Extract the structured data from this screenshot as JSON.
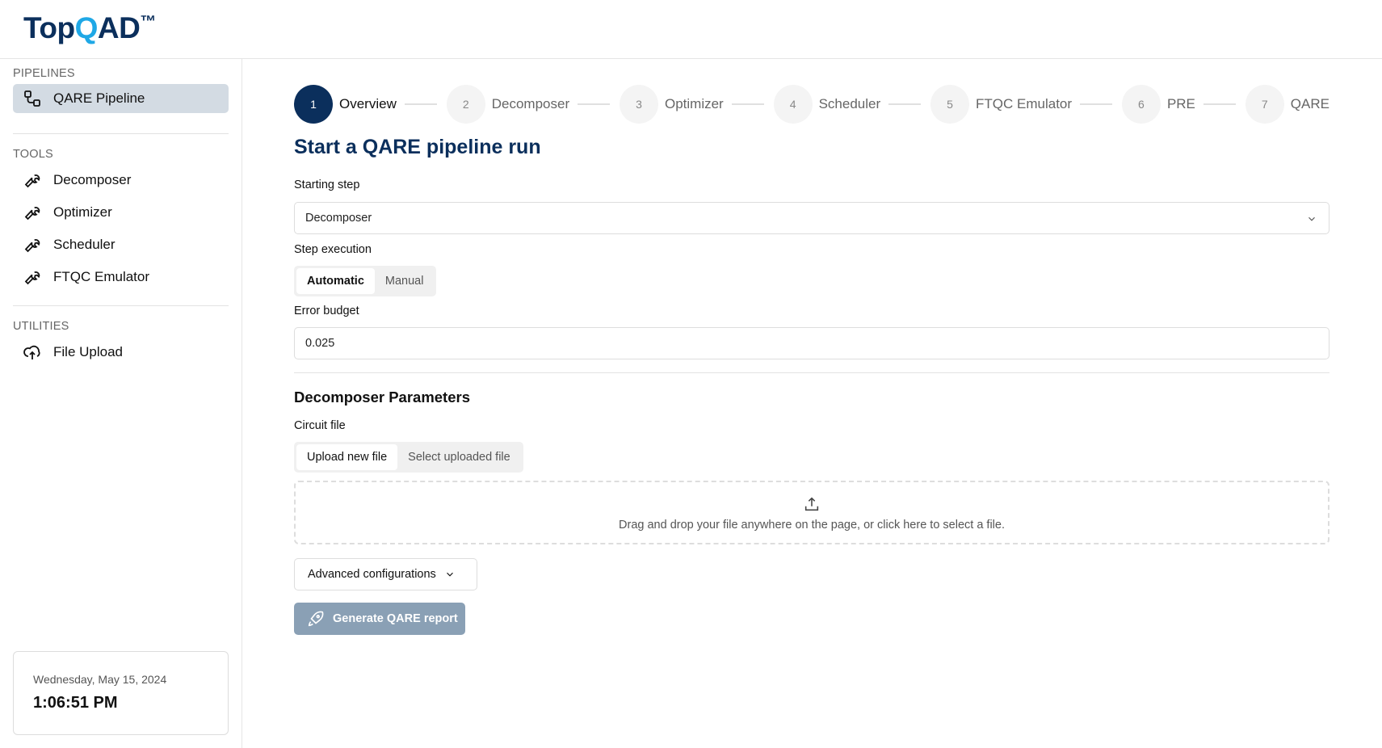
{
  "header": {
    "logo": "TopQAD™"
  },
  "sidebar": {
    "sections": [
      {
        "title": "PIPELINES",
        "items": [
          {
            "label": "QARE Pipeline",
            "icon": "workflow-icon",
            "active": true
          }
        ]
      },
      {
        "title": "TOOLS",
        "items": [
          {
            "label": "Decomposer",
            "icon": "wrench-icon"
          },
          {
            "label": "Optimizer",
            "icon": "wrench-icon"
          },
          {
            "label": "Scheduler",
            "icon": "wrench-icon"
          },
          {
            "label": "FTQC Emulator",
            "icon": "wrench-icon"
          }
        ]
      },
      {
        "title": "UTILITIES",
        "items": [
          {
            "label": "File Upload",
            "icon": "cloud-upload-icon"
          }
        ]
      }
    ],
    "clock": {
      "date": "Wednesday, May 15, 2024",
      "time": "1:06:51 PM"
    }
  },
  "stepper": [
    {
      "num": "1",
      "label": "Overview",
      "active": true
    },
    {
      "num": "2",
      "label": "Decomposer"
    },
    {
      "num": "3",
      "label": "Optimizer"
    },
    {
      "num": "4",
      "label": "Scheduler"
    },
    {
      "num": "5",
      "label": "FTQC Emulator"
    },
    {
      "num": "6",
      "label": "PRE"
    },
    {
      "num": "7",
      "label": "QARE"
    }
  ],
  "form": {
    "title": "Start a QARE pipeline run",
    "starting_step_label": "Starting step",
    "starting_step_value": "Decomposer",
    "step_execution_label": "Step execution",
    "step_execution_options": [
      "Automatic",
      "Manual"
    ],
    "error_budget_label": "Error budget",
    "error_budget_value": "0.025",
    "params_title": "Decomposer Parameters",
    "circuit_file_label": "Circuit file",
    "circuit_file_options": [
      "Upload new file",
      "Select uploaded file"
    ],
    "dropzone_text": "Drag and drop your file anywhere on the page, or click here to select a file.",
    "advanced_label": "Advanced configurations",
    "generate_label": "Generate QARE report"
  },
  "colors": {
    "brand": "#0b2f5c",
    "accent": "#1fa8e6",
    "button_disabled": "#8aa0b5",
    "active_item": "#d3dbe3"
  }
}
